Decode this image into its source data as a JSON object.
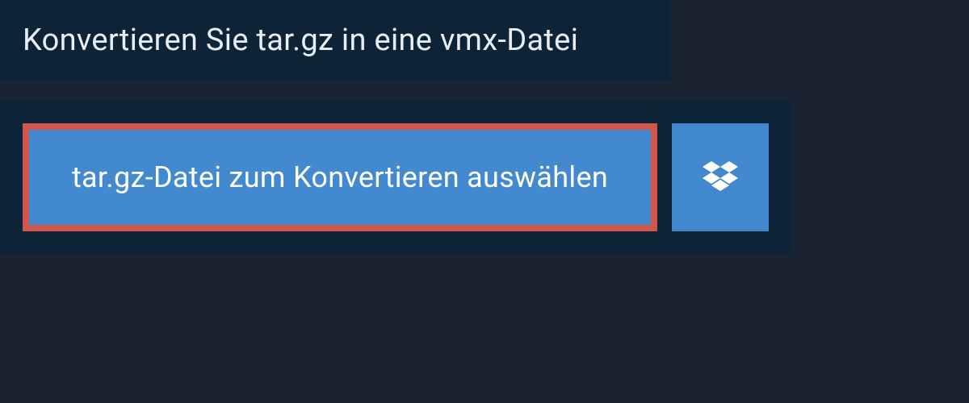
{
  "header": {
    "title": "Konvertieren Sie tar.gz in eine vmx-Datei"
  },
  "upload": {
    "select_label": "tar.gz-Datei zum Konvertieren auswählen"
  },
  "colors": {
    "bg_outer": "#1a2332",
    "bg_panel": "#0d2438",
    "button_blue": "#4289cf",
    "button_border": "#d2564b",
    "text_light": "#e8eef4"
  }
}
